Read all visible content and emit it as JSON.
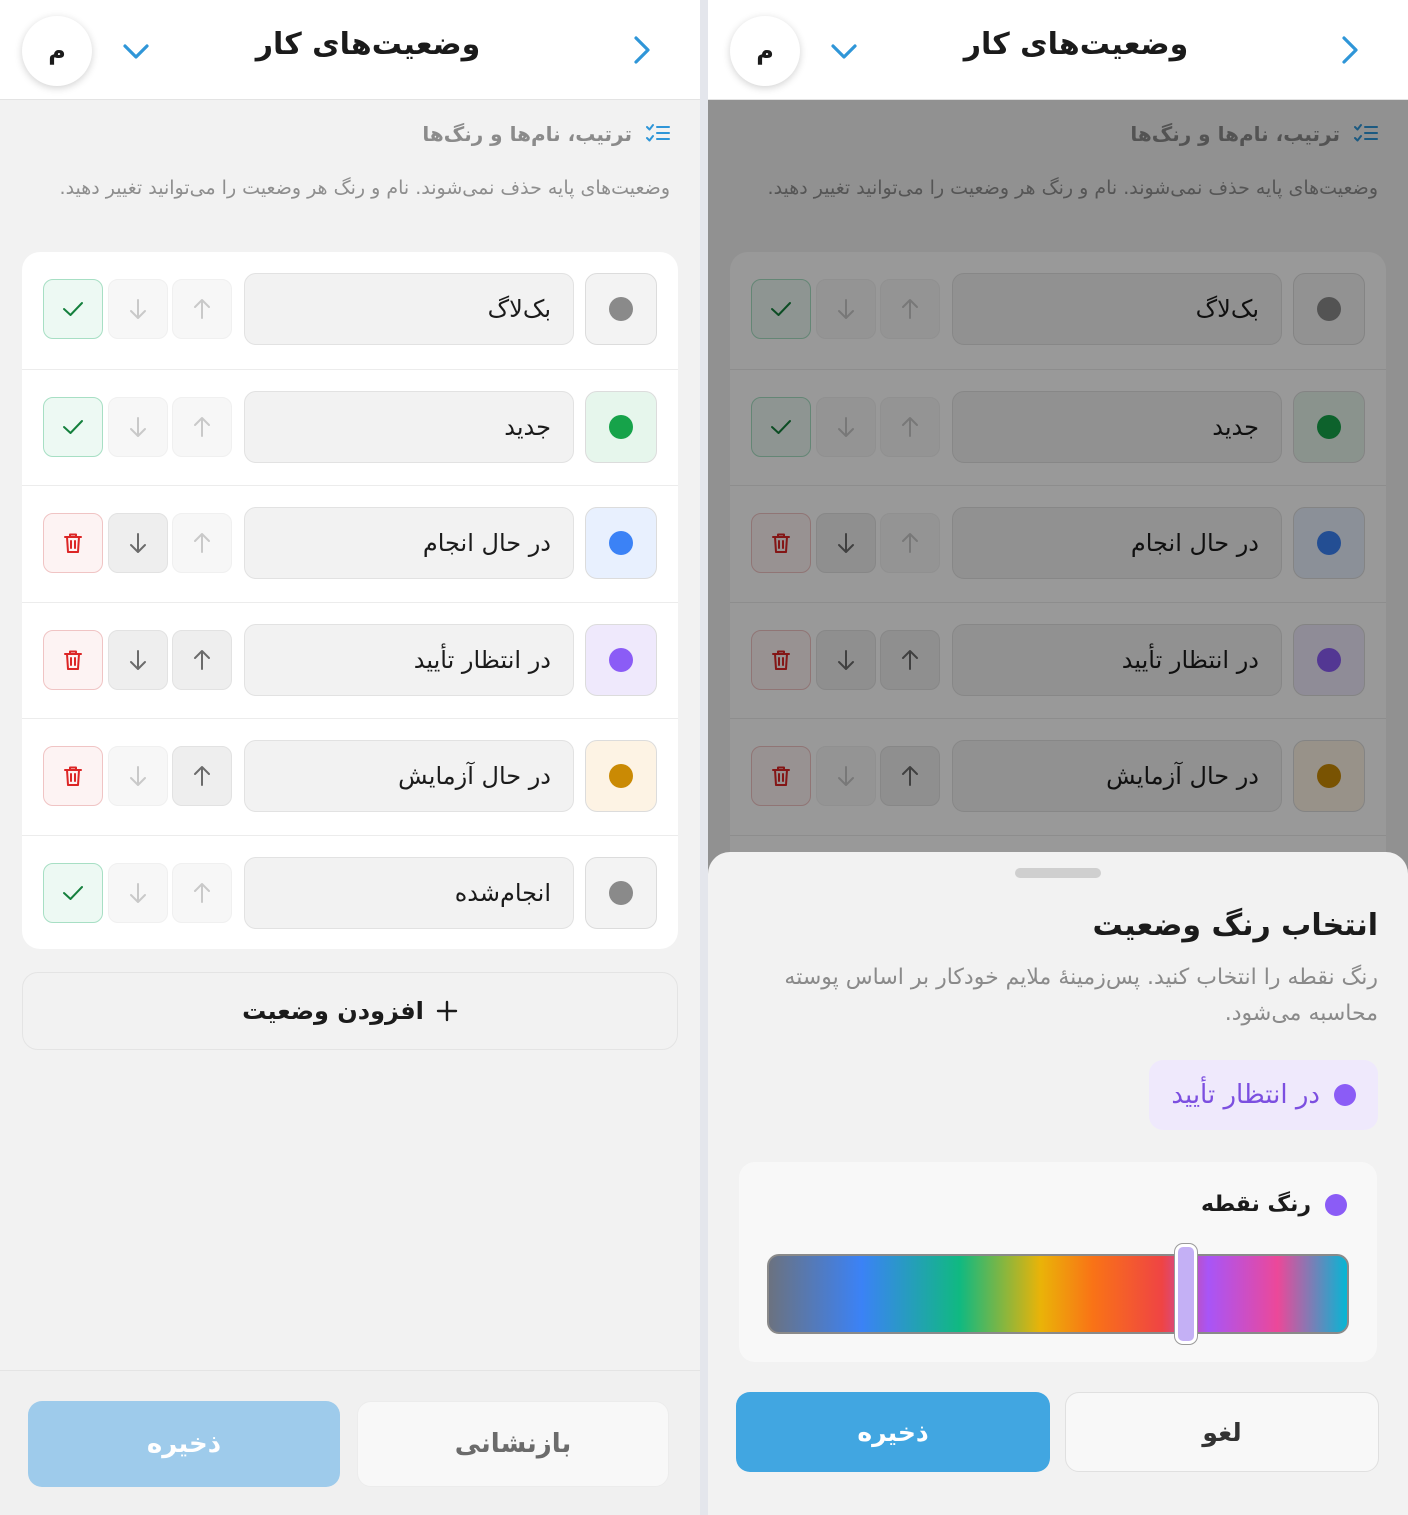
{
  "header": {
    "title": "وضعیت‌های کار",
    "avatar_initial": "م"
  },
  "section": {
    "title": "ترتیب، نام‌ها و رنگ‌ها",
    "description": "وضعیت‌های پایه حذف نمی‌شوند. نام و رنگ هر وضعیت را می‌توانید تغییر دهید."
  },
  "statuses": [
    {
      "name": "بک‌لاگ",
      "dot_color": "#8a8a8a",
      "swatch_bg": "#f3f3f3",
      "can_move_up": false,
      "can_move_down": false,
      "action": "check"
    },
    {
      "name": "جدید",
      "dot_color": "#16a34a",
      "swatch_bg": "#e6f6ec",
      "can_move_up": false,
      "can_move_down": false,
      "action": "check"
    },
    {
      "name": "در حال انجام",
      "dot_color": "#3b82f6",
      "swatch_bg": "#e8f0fe",
      "can_move_up": false,
      "can_move_down": true,
      "action": "trash"
    },
    {
      "name": "در انتظار تأیید",
      "dot_color": "#8b5cf6",
      "swatch_bg": "#efe9fc",
      "can_move_up": true,
      "can_move_down": true,
      "action": "trash"
    },
    {
      "name": "در حال آزمایش",
      "dot_color": "#ca8a04",
      "swatch_bg": "#fdf3e4",
      "can_move_up": true,
      "can_move_down": false,
      "action": "trash"
    },
    {
      "name": "انجام‌شده",
      "dot_color": "#8a8a8a",
      "swatch_bg": "#f3f3f3",
      "can_move_up": false,
      "can_move_down": false,
      "action": "check"
    }
  ],
  "add_button_label": "افزودن وضعیت",
  "footer": {
    "save_label": "ذخیره",
    "reset_label": "بازنشانی"
  },
  "sheet": {
    "title": "انتخاب رنگ وضعیت",
    "description": "رنگ نقطه را انتخاب کنید. پس‌زمینهٔ ملایم خودکار بر اساس پوسته محاسبه می‌شود.",
    "preview_label": "در انتظار تأیید",
    "picker_label": "رنگ نقطه",
    "selected_color": "#8b5cf6",
    "hue_fraction": 0.72,
    "save_label": "ذخیره",
    "cancel_label": "لغو"
  },
  "colors": {
    "accent": "#2f96d8",
    "save_disabled": "#9ecbeb",
    "save_active": "#41a6e1"
  },
  "icons": [
    "back-chevron-right-icon",
    "chevron-down-icon",
    "checklist-icon",
    "arrow-up-icon",
    "arrow-down-icon",
    "check-icon",
    "trash-icon",
    "plus-icon"
  ]
}
